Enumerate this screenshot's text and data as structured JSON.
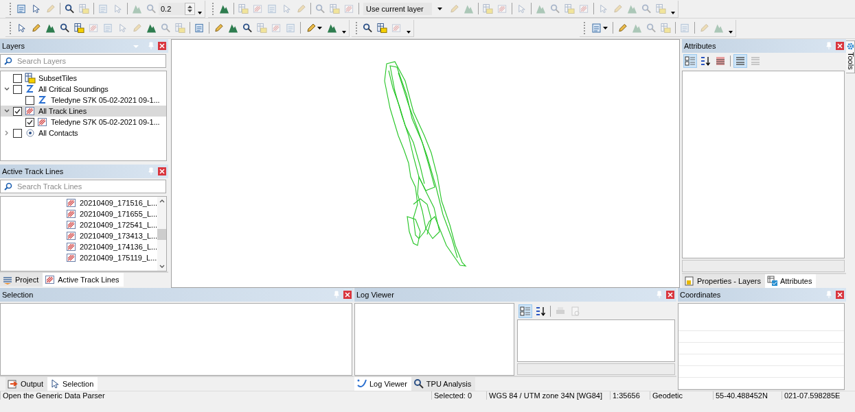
{
  "toolbar_rows": [
    [
      {
        "items": [
          {
            "kind": "button",
            "disabled": false
          },
          {
            "kind": "button",
            "disabled": false
          },
          {
            "kind": "button",
            "disabled": true
          },
          {
            "kind": "separator"
          },
          {
            "kind": "button",
            "disabled": false
          },
          {
            "kind": "button",
            "disabled": true
          },
          {
            "kind": "separator"
          },
          {
            "kind": "button",
            "disabled": true
          },
          {
            "kind": "button",
            "disabled": true
          },
          {
            "kind": "separator"
          },
          {
            "kind": "button",
            "disabled": true
          },
          {
            "kind": "button",
            "disabled": true
          },
          {
            "kind": "spin",
            "value": "0.2"
          },
          {
            "kind": "overflow"
          }
        ]
      },
      {
        "items": [
          {
            "kind": "button",
            "disabled": false
          },
          {
            "kind": "separator"
          },
          {
            "kind": "button",
            "disabled": true
          },
          {
            "kind": "button",
            "disabled": true
          },
          {
            "kind": "button",
            "disabled": true
          },
          {
            "kind": "button",
            "disabled": true
          },
          {
            "kind": "button",
            "disabled": true
          },
          {
            "kind": "separator"
          },
          {
            "kind": "button",
            "disabled": true
          },
          {
            "kind": "button",
            "disabled": true
          },
          {
            "kind": "button",
            "disabled": true
          },
          {
            "kind": "separator"
          },
          {
            "kind": "combo",
            "value": "Use current layer"
          },
          {
            "kind": "button",
            "disabled": true
          },
          {
            "kind": "button",
            "disabled": true
          },
          {
            "kind": "separator"
          },
          {
            "kind": "button",
            "disabled": true
          },
          {
            "kind": "button",
            "disabled": true
          },
          {
            "kind": "separator"
          },
          {
            "kind": "button",
            "disabled": true
          },
          {
            "kind": "separator"
          },
          {
            "kind": "button",
            "disabled": true
          },
          {
            "kind": "button",
            "disabled": true
          },
          {
            "kind": "button",
            "disabled": true
          },
          {
            "kind": "button",
            "disabled": true
          },
          {
            "kind": "separator"
          },
          {
            "kind": "button",
            "disabled": true
          },
          {
            "kind": "button",
            "disabled": true
          },
          {
            "kind": "button",
            "disabled": true
          },
          {
            "kind": "button",
            "disabled": true
          },
          {
            "kind": "button",
            "disabled": true
          },
          {
            "kind": "overflow"
          }
        ]
      }
    ],
    [
      {
        "items": [
          {
            "kind": "button",
            "disabled": false
          },
          {
            "kind": "button",
            "disabled": false
          },
          {
            "kind": "button",
            "disabled": false
          },
          {
            "kind": "button",
            "disabled": false
          },
          {
            "kind": "button",
            "disabled": false
          },
          {
            "kind": "button",
            "disabled": true
          },
          {
            "kind": "button",
            "disabled": true
          },
          {
            "kind": "button",
            "disabled": true
          },
          {
            "kind": "button",
            "disabled": true
          },
          {
            "kind": "button",
            "disabled": false
          },
          {
            "kind": "button",
            "disabled": true
          },
          {
            "kind": "button",
            "disabled": true
          },
          {
            "kind": "separator"
          },
          {
            "kind": "button",
            "disabled": false
          },
          {
            "kind": "separator"
          },
          {
            "kind": "button",
            "disabled": false
          },
          {
            "kind": "button",
            "disabled": false
          },
          {
            "kind": "button",
            "disabled": false
          },
          {
            "kind": "button",
            "disabled": true
          },
          {
            "kind": "button",
            "disabled": true
          },
          {
            "kind": "button",
            "disabled": true
          },
          {
            "kind": "separator"
          },
          {
            "kind": "dropdown",
            "disabled": false
          },
          {
            "kind": "button",
            "disabled": false
          },
          {
            "kind": "overflow"
          }
        ]
      },
      {
        "items": [
          {
            "kind": "button",
            "disabled": false
          },
          {
            "kind": "button",
            "disabled": false
          },
          {
            "kind": "button",
            "disabled": true
          },
          {
            "kind": "overflow"
          }
        ]
      },
      {
        "items": [
          {
            "kind": "dropdown",
            "disabled": false
          },
          {
            "kind": "separator"
          },
          {
            "kind": "button",
            "disabled": false
          },
          {
            "kind": "button",
            "disabled": true
          },
          {
            "kind": "button",
            "disabled": true
          },
          {
            "kind": "button",
            "disabled": true
          },
          {
            "kind": "separator"
          },
          {
            "kind": "button",
            "disabled": true
          },
          {
            "kind": "separator"
          },
          {
            "kind": "button",
            "disabled": true
          },
          {
            "kind": "button",
            "disabled": true
          },
          {
            "kind": "overflow"
          }
        ]
      }
    ]
  ],
  "layers_panel": {
    "title": "Layers",
    "search": {
      "placeholder": "Search Layers"
    },
    "tree": [
      {
        "label": "SubsetTiles",
        "kind": "tiles",
        "checked": false,
        "selected": false
      },
      {
        "label": "All Critical Soundings",
        "kind": "soundings",
        "checked": false,
        "selected": false,
        "expanded": true,
        "children": [
          {
            "label": "Teledyne S7K 05-02-2021 09-1...",
            "kind": "soundings",
            "checked": false,
            "selected": false
          }
        ]
      },
      {
        "label": "All Track Lines",
        "kind": "tracks",
        "checked": true,
        "selected": true,
        "expanded": true,
        "children": [
          {
            "label": "Teledyne S7K 05-02-2021 09-1...",
            "kind": "tracks",
            "checked": true,
            "selected": false
          }
        ]
      },
      {
        "label": "All Contacts",
        "kind": "contacts",
        "checked": false,
        "selected": false,
        "expanded": false
      }
    ]
  },
  "track_lines_panel": {
    "title": "Active Track Lines",
    "search": {
      "placeholder": "Search Track Lines"
    },
    "items": [
      "20210409_171516_L...",
      "20210409_171655_L...",
      "20210409_172541_L...",
      "20210409_173413_L...",
      "20210409_174136_L...",
      "20210409_175119_L..."
    ]
  },
  "left_tabs": [
    {
      "label": "Project",
      "kind": "project",
      "selected": false
    },
    {
      "label": "Active Track Lines",
      "kind": "tracks",
      "selected": true
    }
  ],
  "attributes_panel": {
    "title": "Attributes",
    "tabs": [
      {
        "label": "Properties - Layers",
        "kind": "properties",
        "selected": false
      },
      {
        "label": "Attributes",
        "kind": "attributes",
        "selected": true
      }
    ]
  },
  "side_tab": {
    "label": "Tools"
  },
  "selection_panel": {
    "title": "Selection",
    "tabs": [
      {
        "label": "Output",
        "kind": "output",
        "selected": false
      },
      {
        "label": "Selection",
        "kind": "selection",
        "selected": true
      }
    ]
  },
  "log_panel": {
    "title": "Log Viewer",
    "tabs": [
      {
        "label": "Log Viewer",
        "kind": "log",
        "selected": true
      },
      {
        "label": "TPU Analysis",
        "kind": "tpu",
        "selected": false
      }
    ]
  },
  "coordinates_panel": {
    "title": "Coordinates"
  },
  "status_bar": [
    "Open the Generic Data Parser",
    "Selected: 0",
    "WGS 84 / UTM zone 34N [WG84]",
    "1:35656",
    "Geodetic",
    "55-40.488452N",
    "021-07.598285E"
  ]
}
